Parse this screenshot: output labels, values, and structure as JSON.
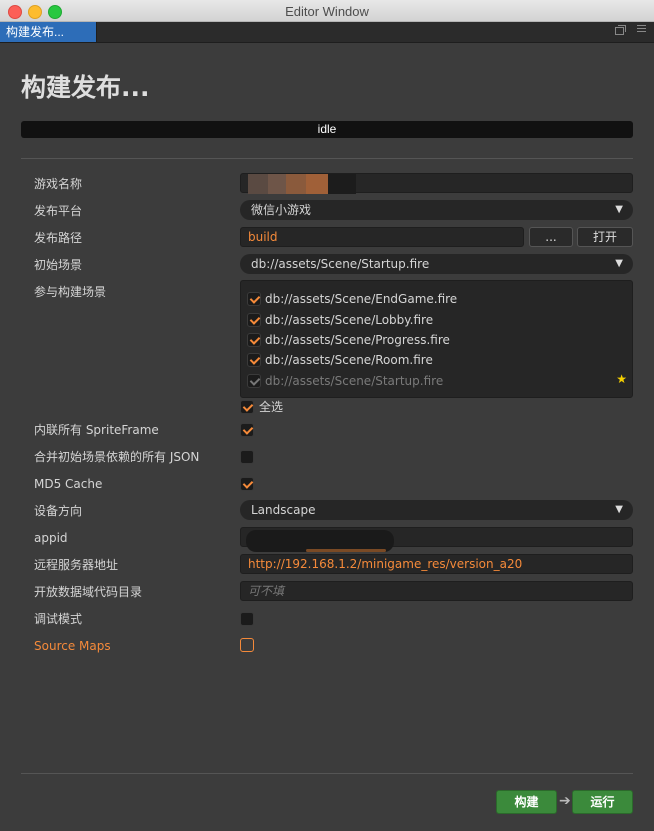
{
  "window": {
    "title": "Editor Window"
  },
  "tab": {
    "label": "构建发布..."
  },
  "page": {
    "title": "构建发布...",
    "status": "idle"
  },
  "form": {
    "game_name": {
      "label": "游戏名称",
      "value": ""
    },
    "platform": {
      "label": "发布平台",
      "value": "微信小游戏"
    },
    "build_path": {
      "label": "发布路径",
      "value": "build",
      "browse_label": "...",
      "open_label": "打开"
    },
    "start_scene": {
      "label": "初始场景",
      "value": "db://assets/Scene/Startup.fire"
    },
    "scenes": {
      "label": "参与构建场景",
      "items": [
        {
          "path": "db://assets/Scene/EndGame.fire",
          "checked": true
        },
        {
          "path": "db://assets/Scene/Lobby.fire",
          "checked": true
        },
        {
          "path": "db://assets/Scene/Progress.fire",
          "checked": true
        },
        {
          "path": "db://assets/Scene/Room.fire",
          "checked": true
        },
        {
          "path": "db://assets/Scene/Startup.fire",
          "checked": true,
          "disabled": true
        }
      ],
      "select_all_label": "全选"
    },
    "inline_sprite": {
      "label": "内联所有 SpriteFrame",
      "checked": true
    },
    "merge_json": {
      "label": "合并初始场景依赖的所有 JSON",
      "checked": false
    },
    "md5": {
      "label": "MD5 Cache",
      "checked": true
    },
    "orientation": {
      "label": "设备方向",
      "value": "Landscape"
    },
    "appid": {
      "label": "appid",
      "value": ""
    },
    "remote_server": {
      "label": "远程服务器地址",
      "value": "http://192.168.1.2/minigame_res/version_a20"
    },
    "open_data": {
      "label": "开放数据域代码目录",
      "placeholder": "可不填"
    },
    "debug": {
      "label": "调试模式",
      "checked": false
    },
    "source_maps": {
      "label": "Source Maps",
      "checked": false
    }
  },
  "actions": {
    "build_label": "构建",
    "run_label": "运行"
  },
  "colors": {
    "accent": "#f58a3a",
    "tab": "#2d6db8",
    "action": "#3b8a3b"
  }
}
